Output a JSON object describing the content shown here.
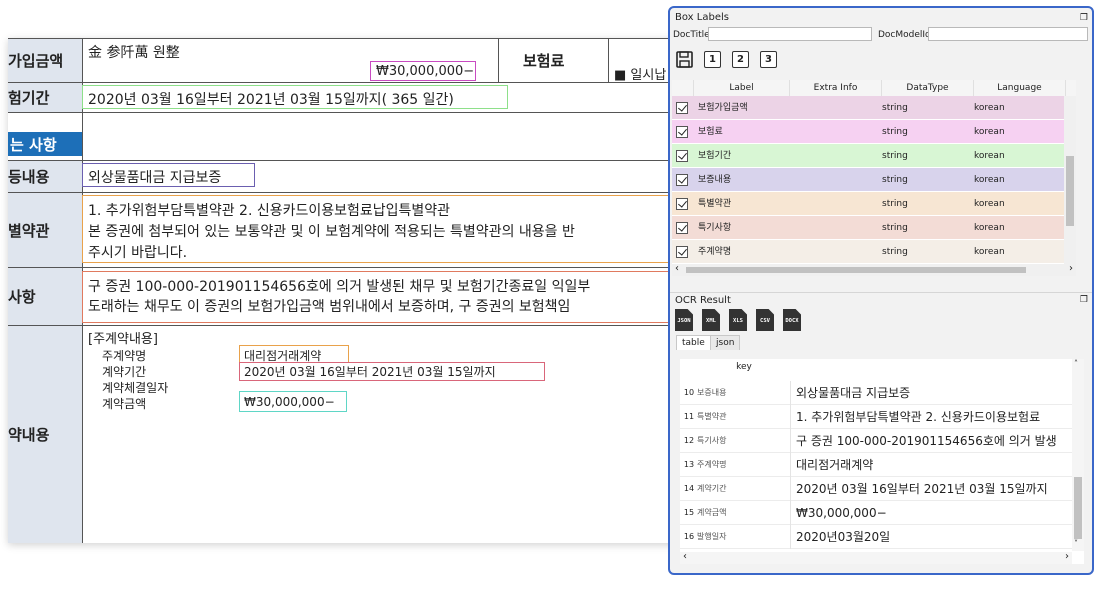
{
  "document": {
    "rows": {
      "insured_amount": {
        "label": "가입금액",
        "text": "金 参阡萬 원整",
        "amount": "₩30,000,000−"
      },
      "premium": {
        "label": "보험료",
        "text": "■ 일시납"
      },
      "period": {
        "label": "험기간",
        "text": "2020년 03월 16일부터  2021년 03월 15일까지( 365 일간)"
      },
      "section_banner": "는 사항",
      "content": {
        "label": "등내용",
        "text": "외상물품대금 지급보증"
      },
      "special_terms": {
        "label": "별약관",
        "lines": [
          "1. 추가위험부담특별약관 2. 신용카드이용보험료납입특별약관",
          "본 증권에 첨부되어 있는 보통약관 및 이 보험계약에 적용되는 특별약관의 내용을 반",
          "주시기 바랍니다."
        ]
      },
      "special_notes": {
        "label": "사항",
        "lines": [
          "구 증권 100-000-201901154656호에 의거 발생된 채무 및 보험기간종료일 익일부",
          "도래하는 채무도 이 증권의 보험가입금액 범위내에서 보증하며, 구 증권의 보험책임"
        ]
      },
      "main_contract": {
        "label": "약내용",
        "header": "[주계약내용]",
        "fields": [
          {
            "key": "주계약명",
            "value": "대리점거래계약"
          },
          {
            "key": "계약기간",
            "value": "2020년 03월 16일부터 2021년 03월 15일까지"
          },
          {
            "key": "계약체결일자",
            "value": ""
          },
          {
            "key": "계약금액",
            "value": "₩30,000,000−"
          }
        ]
      }
    }
  },
  "box_labels": {
    "title": "Box Labels",
    "doc_title_label": "DocTitle",
    "doc_model_label": "DocModelId",
    "toolbar": [
      "1",
      "2",
      "3"
    ],
    "columns": [
      "Label",
      "Extra Info",
      "DataType",
      "Language"
    ],
    "rows": [
      {
        "label": "보험가입금액",
        "extra": "",
        "type": "string",
        "lang": "korean",
        "n": "3",
        "color": "#ecd3e6"
      },
      {
        "label": "보험료",
        "extra": "",
        "type": "string",
        "lang": "korean",
        "n": "3",
        "color": "#f6d1f2"
      },
      {
        "label": "보험기간",
        "extra": "",
        "type": "string",
        "lang": "korean",
        "n": "3",
        "color": "#d8f6d4"
      },
      {
        "label": "보증내용",
        "extra": "",
        "type": "string",
        "lang": "korean",
        "n": "3",
        "color": "#d8d3ec"
      },
      {
        "label": "특별약관",
        "extra": "",
        "type": "string",
        "lang": "korean",
        "n": "3",
        "color": "#f7e6d3"
      },
      {
        "label": "특기사항",
        "extra": "",
        "type": "string",
        "lang": "korean",
        "n": "3",
        "color": "#f3dcd6"
      },
      {
        "label": "주계약명",
        "extra": "",
        "type": "string",
        "lang": "korean",
        "n": "3",
        "color": "#f4eee7"
      }
    ]
  },
  "ocr_result": {
    "title": "OCR Result",
    "icons": [
      "JSON",
      "XML",
      "XLS",
      "CSV",
      "DOCX"
    ],
    "tabs": [
      "table",
      "json"
    ],
    "key_header": "key",
    "rows": [
      {
        "n": "10",
        "key": "보증내용",
        "value": "외상물품대금 지급보증"
      },
      {
        "n": "11",
        "key": "특별약관",
        "value": "1. 추가위험부담특별약관 2. 신용카드이용보험료"
      },
      {
        "n": "12",
        "key": "특기사항",
        "value": "구 증권 100-000-201901154656호에 의거 발생"
      },
      {
        "n": "13",
        "key": "주계약명",
        "value": "대리점거래계약"
      },
      {
        "n": "14",
        "key": "계약기간",
        "value": "2020년 03월 16일부터 2021년 03월 15일까지"
      },
      {
        "n": "15",
        "key": "계약금액",
        "value": "₩30,000,000−"
      },
      {
        "n": "16",
        "key": "발행일자",
        "value": "2020년03월20일"
      }
    ]
  }
}
